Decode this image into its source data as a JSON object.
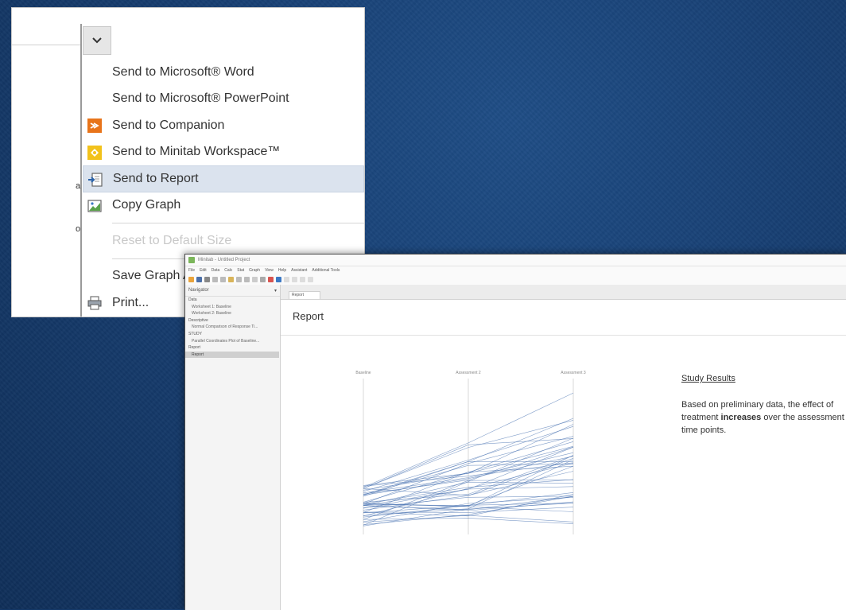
{
  "menu": {
    "items": [
      {
        "label": "Send to Microsoft® Word",
        "icon": "none"
      },
      {
        "label": "Send to Microsoft® PowerPoint",
        "icon": "none"
      },
      {
        "label": "Send to Companion",
        "icon": "companion-icon"
      },
      {
        "label": "Send to Minitab Workspace™",
        "icon": "workspace-icon"
      },
      {
        "label": "Send to Report",
        "icon": "report-icon",
        "selected": true
      },
      {
        "label": "Copy Graph",
        "icon": "copy-graph-icon"
      },
      {
        "label": "Reset to Default Size",
        "icon": "none",
        "disabled": true
      },
      {
        "label": "Save Graph As...",
        "icon": "none"
      },
      {
        "label": "Print...",
        "icon": "printer-icon"
      }
    ],
    "left_pane_fragments": [
      "a",
      "o"
    ]
  },
  "app": {
    "title": "Minitab - Untitled Project",
    "menubar": [
      "File",
      "Edit",
      "Data",
      "Calc",
      "Stat",
      "Graph",
      "View",
      "Help",
      "Assistant",
      "Additional Tools"
    ],
    "navigator": {
      "header": "Navigator",
      "items": [
        {
          "label": "Data",
          "type": "group"
        },
        {
          "label": "Worksheet 1: Baseline",
          "type": "item"
        },
        {
          "label": "Worksheet 2: Baseline",
          "type": "item"
        },
        {
          "label": "Descriptive",
          "type": "group"
        },
        {
          "label": "Normal Comparison of Response Ti...",
          "type": "item"
        },
        {
          "label": "STUDY",
          "type": "group"
        },
        {
          "label": "Parallel Coordinates Plot of Baseline...",
          "type": "item"
        },
        {
          "label": "Report",
          "type": "group"
        },
        {
          "label": "Report",
          "type": "item",
          "active": true
        }
      ]
    },
    "tab_label": "Report",
    "report_title": "Report",
    "study": {
      "title": "Study Results",
      "text_before": "Based on preliminary data, the effect of treatment ",
      "text_bold": "increases",
      "text_after": " over the assessment time points."
    },
    "chart_labels": [
      "Baseline",
      "Assessment 2",
      "Assessment 3"
    ]
  },
  "colors": {
    "menu_selected": "#dbe3ee",
    "companion_icon": "#e8741a",
    "workspace_icon": "#f2c21b",
    "plot_line": "#4a74b2"
  }
}
